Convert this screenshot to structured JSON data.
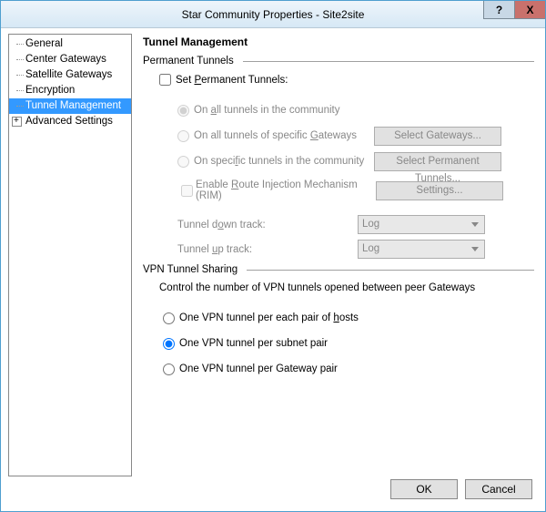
{
  "title": "Star Community Properties - Site2site",
  "help_icon": "?",
  "close_icon": "X",
  "sidebar": {
    "items": [
      {
        "label": "General"
      },
      {
        "label": "Center Gateways"
      },
      {
        "label": "Satellite Gateways"
      },
      {
        "label": "Encryption"
      },
      {
        "label": "Tunnel Management",
        "selected": true
      },
      {
        "label": "Advanced Settings",
        "expandable": true
      }
    ]
  },
  "main": {
    "heading": "Tunnel Management",
    "permanent_section": "Permanent Tunnels",
    "set_permanent_label": "Set Permanent Tunnels:",
    "radios": {
      "all": "On all tunnels in the community",
      "specific_gw": "On all tunnels of specific Gateways",
      "specific_tun": "On specific tunnels in the community"
    },
    "buttons": {
      "select_gw": "Select Gateways...",
      "select_tun": "Select Permanent Tunnels...",
      "rim_settings": "Settings..."
    },
    "rim_label": "Enable Route Injection Mechanism (RIM)",
    "tunnel_down_label": "Tunnel down track:",
    "tunnel_up_label": "Tunnel up track:",
    "select_value_down": "Log",
    "select_value_up": "Log",
    "sharing_section": "VPN Tunnel Sharing",
    "sharing_intro": "Control the number of VPN tunnels opened between peer Gateways",
    "sharing_radios": {
      "hosts": "One VPN tunnel per each pair of hosts",
      "subnet": "One VPN tunnel per subnet pair",
      "gateway": "One VPN tunnel per Gateway pair"
    }
  },
  "footer": {
    "ok": "OK",
    "cancel": "Cancel"
  }
}
